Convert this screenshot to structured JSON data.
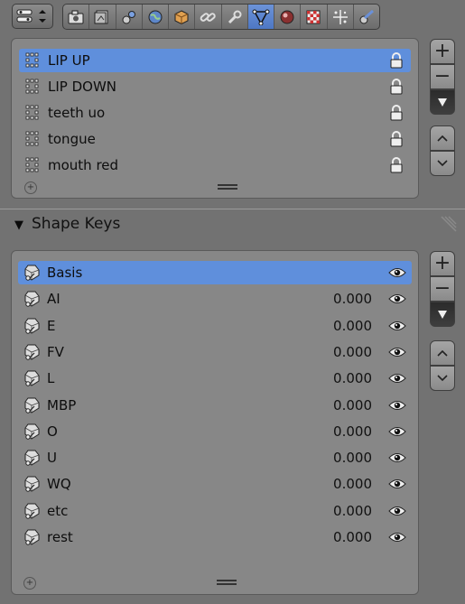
{
  "vertex_groups": {
    "items": [
      {
        "label": "LIP UP",
        "selected": true
      },
      {
        "label": "LIP DOWN",
        "selected": false
      },
      {
        "label": "teeth uo",
        "selected": false
      },
      {
        "label": "tongue",
        "selected": false
      },
      {
        "label": "mouth red",
        "selected": false
      }
    ]
  },
  "shape_keys": {
    "section_title": "Shape Keys",
    "items": [
      {
        "label": "Basis",
        "value": "",
        "selected": true
      },
      {
        "label": "AI",
        "value": "0.000",
        "selected": false
      },
      {
        "label": "E",
        "value": "0.000",
        "selected": false
      },
      {
        "label": "FV",
        "value": "0.000",
        "selected": false
      },
      {
        "label": "L",
        "value": "0.000",
        "selected": false
      },
      {
        "label": "MBP",
        "value": "0.000",
        "selected": false
      },
      {
        "label": "O",
        "value": "0.000",
        "selected": false
      },
      {
        "label": "U",
        "value": "0.000",
        "selected": false
      },
      {
        "label": "WQ",
        "value": "0.000",
        "selected": false
      },
      {
        "label": "etc",
        "value": "0.000",
        "selected": false
      },
      {
        "label": "rest",
        "value": "0.000",
        "selected": false
      }
    ]
  },
  "toolbar": {
    "tabs": [
      "render",
      "render-layers",
      "scene",
      "world",
      "object",
      "constraints",
      "modifiers",
      "data",
      "material",
      "texture",
      "particles",
      "physics"
    ],
    "active_tab": "data"
  },
  "colors": {
    "background": "#727272",
    "panel": "#878787",
    "selection": "#5f8fdc"
  }
}
